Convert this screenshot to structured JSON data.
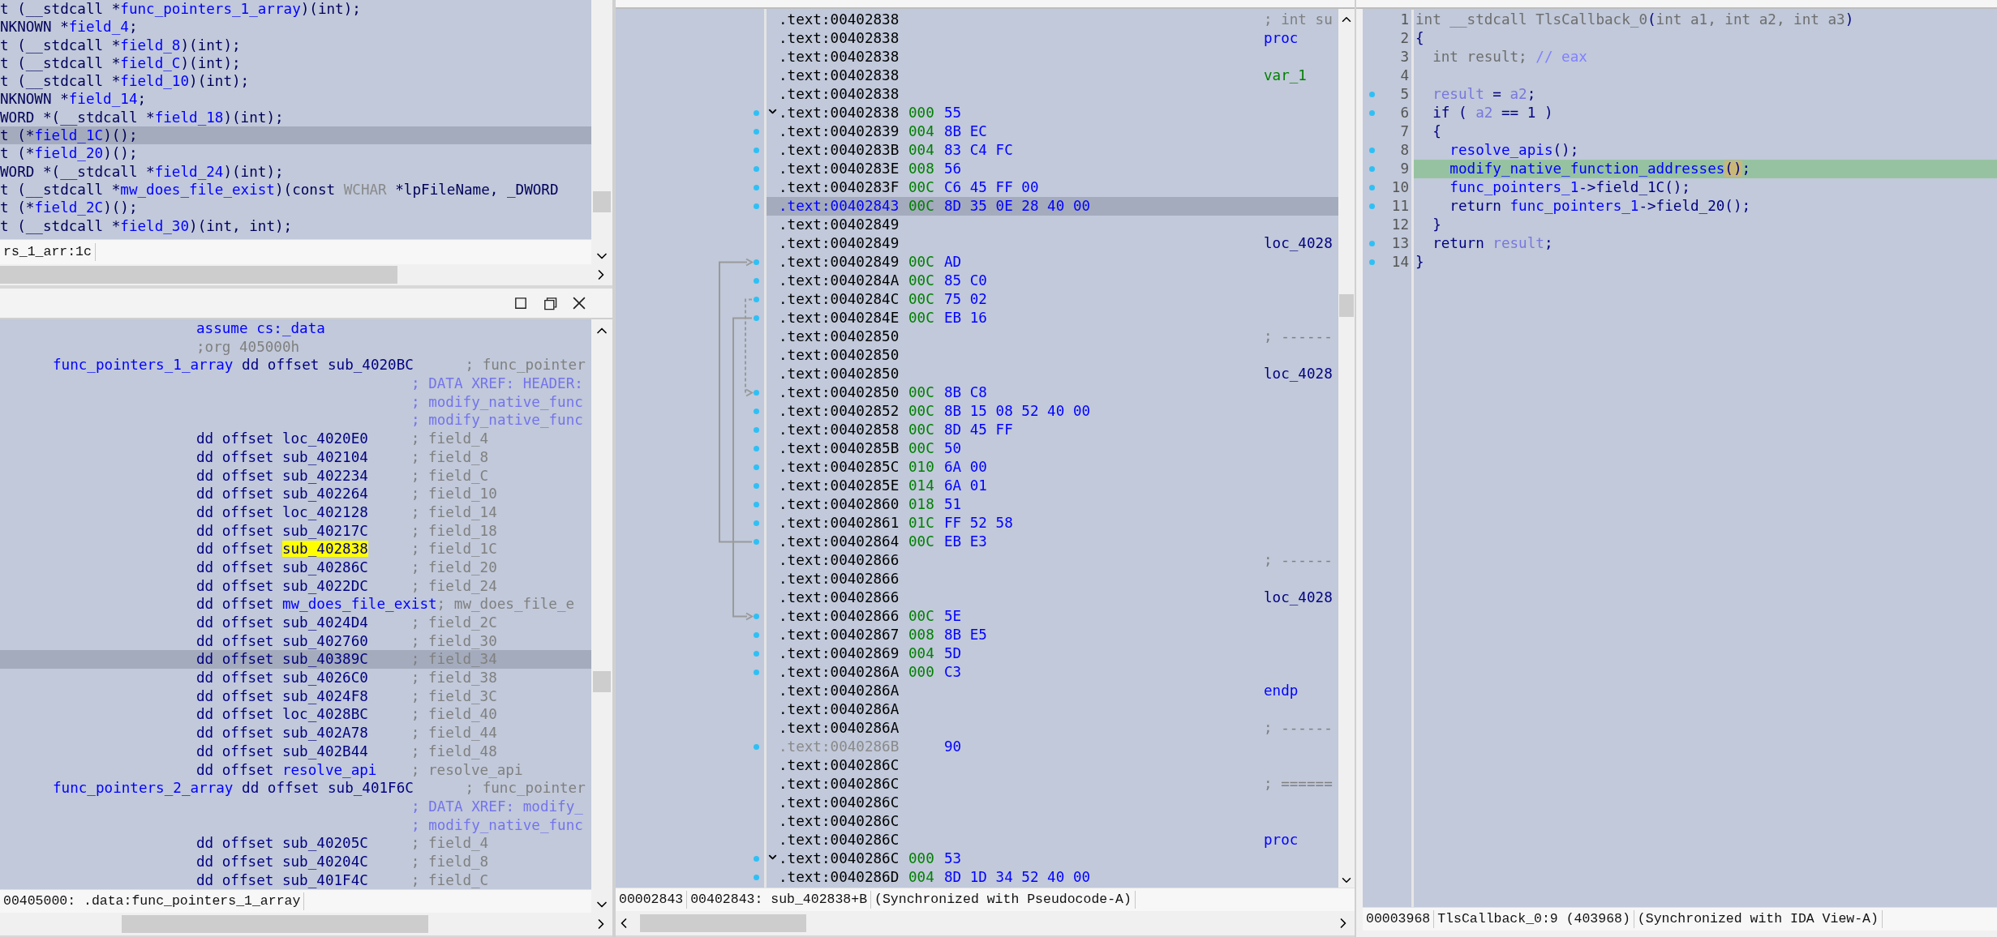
{
  "structure_pane": {
    "lines": [
      {
        "selected": false,
        "segs": [
          {
            "kind": "text",
            "text": "t (__stdcall *"
          },
          {
            "kind": "name",
            "text": "func_pointers_1_array"
          },
          {
            "kind": "text",
            "text": ")(int);"
          }
        ]
      },
      {
        "selected": false,
        "segs": [
          {
            "kind": "text",
            "text": "NKNOWN *"
          },
          {
            "kind": "name",
            "text": "field_4"
          },
          {
            "kind": "text",
            "text": ";"
          }
        ]
      },
      {
        "selected": false,
        "segs": [
          {
            "kind": "text",
            "text": "t (__stdcall *"
          },
          {
            "kind": "name",
            "text": "field_8"
          },
          {
            "kind": "text",
            "text": ")(int);"
          }
        ]
      },
      {
        "selected": false,
        "segs": [
          {
            "kind": "text",
            "text": "t (__stdcall *"
          },
          {
            "kind": "name",
            "text": "field_C"
          },
          {
            "kind": "text",
            "text": ")(int);"
          }
        ]
      },
      {
        "selected": false,
        "segs": [
          {
            "kind": "text",
            "text": "t (__stdcall *"
          },
          {
            "kind": "name",
            "text": "field_10"
          },
          {
            "kind": "text",
            "text": ")(int);"
          }
        ]
      },
      {
        "selected": false,
        "segs": [
          {
            "kind": "text",
            "text": "NKNOWN *"
          },
          {
            "kind": "name",
            "text": "field_14"
          },
          {
            "kind": "text",
            "text": ";"
          }
        ]
      },
      {
        "selected": false,
        "segs": [
          {
            "kind": "text",
            "text": "WORD *(__stdcall *"
          },
          {
            "kind": "name",
            "text": "field_18"
          },
          {
            "kind": "text",
            "text": ")(int);"
          }
        ]
      },
      {
        "selected": true,
        "segs": [
          {
            "kind": "text",
            "text": "t (*"
          },
          {
            "kind": "name",
            "text": "field_1C"
          },
          {
            "kind": "text",
            "text": ")();"
          }
        ]
      },
      {
        "selected": false,
        "segs": [
          {
            "kind": "text",
            "text": "t (*"
          },
          {
            "kind": "name",
            "text": "field_20"
          },
          {
            "kind": "text",
            "text": ")();"
          }
        ]
      },
      {
        "selected": false,
        "segs": [
          {
            "kind": "text",
            "text": "WORD *(__stdcall *"
          },
          {
            "kind": "name",
            "text": "field_24"
          },
          {
            "kind": "text",
            "text": ")(int);"
          }
        ]
      },
      {
        "selected": false,
        "segs": [
          {
            "kind": "text",
            "text": "t (__stdcall *"
          },
          {
            "kind": "name",
            "text": "mw_does_file_exist"
          },
          {
            "kind": "text",
            "text": ")(const "
          },
          {
            "kind": "type",
            "text": "WCHAR"
          },
          {
            "kind": "text",
            "text": " *lpFileName, _DWORD"
          }
        ]
      },
      {
        "selected": false,
        "segs": [
          {
            "kind": "text",
            "text": "t (*"
          },
          {
            "kind": "name",
            "text": "field_2C"
          },
          {
            "kind": "text",
            "text": ")();"
          }
        ]
      },
      {
        "selected": false,
        "segs": [
          {
            "kind": "text",
            "text": "t (__stdcall *"
          },
          {
            "kind": "name",
            "text": "field_30"
          },
          {
            "kind": "text",
            "text": ")(int, int);"
          }
        ]
      }
    ],
    "status": "rs_1_arr:1c"
  },
  "data_view": {
    "lines": [
      {
        "kind": "instr",
        "selected": false,
        "segs": [
          {
            "kind": "name",
            "text": "assume cs:_data"
          }
        ]
      },
      {
        "kind": "instr",
        "selected": false,
        "segs": [
          {
            "kind": "comment",
            "text": ";org 405000h"
          }
        ]
      },
      {
        "kind": "label",
        "selected": false,
        "segs": [
          {
            "kind": "name",
            "text": "func_pointers_1_array"
          },
          {
            "kind": "code",
            "text": " dd offset sub_4020BC"
          },
          {
            "kind": "comment",
            "text": "      ; func_pointer"
          }
        ]
      },
      {
        "kind": "comment",
        "selected": false,
        "segs": [
          {
            "kind": "xref",
            "text": "; DATA XREF: HEADER:"
          }
        ]
      },
      {
        "kind": "comment",
        "selected": false,
        "segs": [
          {
            "kind": "xref",
            "text": "; modify_native_func"
          }
        ]
      },
      {
        "kind": "comment",
        "selected": false,
        "segs": [
          {
            "kind": "xref",
            "text": "; modify_native_func"
          }
        ]
      },
      {
        "kind": "instr",
        "selected": false,
        "segs": [
          {
            "kind": "code",
            "text": "dd offset loc_4020E0"
          },
          {
            "kind": "comment",
            "text": "     ; field_4"
          }
        ]
      },
      {
        "kind": "instr",
        "selected": false,
        "segs": [
          {
            "kind": "code",
            "text": "dd offset sub_402104"
          },
          {
            "kind": "comment",
            "text": "     ; field_8"
          }
        ]
      },
      {
        "kind": "instr",
        "selected": false,
        "segs": [
          {
            "kind": "code",
            "text": "dd offset sub_402234"
          },
          {
            "kind": "comment",
            "text": "     ; field_C"
          }
        ]
      },
      {
        "kind": "instr",
        "selected": false,
        "segs": [
          {
            "kind": "code",
            "text": "dd offset sub_402264"
          },
          {
            "kind": "comment",
            "text": "     ; field_10"
          }
        ]
      },
      {
        "kind": "instr",
        "selected": false,
        "segs": [
          {
            "kind": "code",
            "text": "dd offset loc_402128"
          },
          {
            "kind": "comment",
            "text": "     ; field_14"
          }
        ]
      },
      {
        "kind": "instr",
        "selected": false,
        "segs": [
          {
            "kind": "code",
            "text": "dd offset sub_40217C"
          },
          {
            "kind": "comment",
            "text": "     ; field_18"
          }
        ]
      },
      {
        "kind": "instr",
        "selected": false,
        "segs": [
          {
            "kind": "code",
            "text": "dd offset "
          },
          {
            "kind": "hl",
            "text": "sub_402838"
          },
          {
            "kind": "comment",
            "text": "     ; field_1C"
          }
        ]
      },
      {
        "kind": "instr",
        "selected": false,
        "segs": [
          {
            "kind": "code",
            "text": "dd offset sub_40286C"
          },
          {
            "kind": "comment",
            "text": "     ; field_20"
          }
        ]
      },
      {
        "kind": "instr",
        "selected": false,
        "segs": [
          {
            "kind": "code",
            "text": "dd offset sub_4022DC"
          },
          {
            "kind": "comment",
            "text": "     ; field_24"
          }
        ]
      },
      {
        "kind": "instr",
        "selected": false,
        "segs": [
          {
            "kind": "code",
            "text": "dd offset "
          },
          {
            "kind": "name",
            "text": "mw_does_file_exist"
          },
          {
            "kind": "comment",
            "text": "; mw_does_file_e"
          }
        ]
      },
      {
        "kind": "instr",
        "selected": false,
        "segs": [
          {
            "kind": "code",
            "text": "dd offset sub_4024D4"
          },
          {
            "kind": "comment",
            "text": "     ; field_2C"
          }
        ]
      },
      {
        "kind": "instr",
        "selected": false,
        "segs": [
          {
            "kind": "code",
            "text": "dd offset sub_402760"
          },
          {
            "kind": "comment",
            "text": "     ; field_30"
          }
        ]
      },
      {
        "kind": "instr",
        "selected": true,
        "segs": [
          {
            "kind": "code",
            "text": "dd offset sub_40389C"
          },
          {
            "kind": "comment",
            "text": "     ; field_34"
          }
        ]
      },
      {
        "kind": "instr",
        "selected": false,
        "segs": [
          {
            "kind": "code",
            "text": "dd offset sub_4026C0"
          },
          {
            "kind": "comment",
            "text": "     ; field_38"
          }
        ]
      },
      {
        "kind": "instr",
        "selected": false,
        "segs": [
          {
            "kind": "code",
            "text": "dd offset sub_4024F8"
          },
          {
            "kind": "comment",
            "text": "     ; field_3C"
          }
        ]
      },
      {
        "kind": "instr",
        "selected": false,
        "segs": [
          {
            "kind": "code",
            "text": "dd offset loc_4028BC"
          },
          {
            "kind": "comment",
            "text": "     ; field_40"
          }
        ]
      },
      {
        "kind": "instr",
        "selected": false,
        "segs": [
          {
            "kind": "code",
            "text": "dd offset sub_402A78"
          },
          {
            "kind": "comment",
            "text": "     ; field_44"
          }
        ]
      },
      {
        "kind": "instr",
        "selected": false,
        "segs": [
          {
            "kind": "code",
            "text": "dd offset sub_402B44"
          },
          {
            "kind": "comment",
            "text": "     ; field_48"
          }
        ]
      },
      {
        "kind": "instr",
        "selected": false,
        "segs": [
          {
            "kind": "code",
            "text": "dd offset "
          },
          {
            "kind": "name",
            "text": "resolve_api"
          },
          {
            "kind": "comment",
            "text": "    ; resolve_api"
          }
        ]
      },
      {
        "kind": "label",
        "selected": false,
        "segs": [
          {
            "kind": "name",
            "text": "func_pointers_2_array"
          },
          {
            "kind": "code",
            "text": " dd offset sub_401F6C"
          },
          {
            "kind": "comment",
            "text": "      ; func_pointer"
          }
        ]
      },
      {
        "kind": "comment",
        "selected": false,
        "segs": [
          {
            "kind": "xref",
            "text": "; DATA XREF: modify_"
          }
        ]
      },
      {
        "kind": "comment",
        "selected": false,
        "segs": [
          {
            "kind": "xref",
            "text": "; modify_native_func"
          }
        ]
      },
      {
        "kind": "instr",
        "selected": false,
        "segs": [
          {
            "kind": "code",
            "text": "dd offset sub_40205C"
          },
          {
            "kind": "comment",
            "text": "     ; field_4"
          }
        ]
      },
      {
        "kind": "instr",
        "selected": false,
        "segs": [
          {
            "kind": "code",
            "text": "dd offset sub_40204C"
          },
          {
            "kind": "comment",
            "text": "     ; field_8"
          }
        ]
      },
      {
        "kind": "instr",
        "selected": false,
        "segs": [
          {
            "kind": "code",
            "text": "dd offset sub_401F4C"
          },
          {
            "kind": "comment",
            "text": "     ; field_C"
          }
        ]
      }
    ],
    "status": "00405000: .data:func_pointers_1_array"
  },
  "disassembly": {
    "rows": [
      {
        "addr": ".text:00402838",
        "note": {
          "kind": "comment",
          "text": "; int su"
        },
        "selected": false
      },
      {
        "addr": ".text:00402838",
        "note": {
          "kind": "keyword",
          "text": "proc"
        },
        "selected": false
      },
      {
        "addr": ".text:00402838",
        "selected": false
      },
      {
        "addr": ".text:00402838",
        "note": {
          "kind": "var",
          "text": "var_1"
        },
        "selected": false
      },
      {
        "addr": ".text:00402838",
        "selected": false
      },
      {
        "addr": ".text:00402838",
        "sp": "000",
        "bytes": "55",
        "fold": true,
        "selected": false
      },
      {
        "addr": ".text:00402839",
        "sp": "004",
        "bytes": "8B EC",
        "selected": false
      },
      {
        "addr": ".text:0040283B",
        "sp": "004",
        "bytes": "83 C4 FC",
        "selected": false
      },
      {
        "addr": ".text:0040283E",
        "sp": "008",
        "bytes": "56",
        "selected": false
      },
      {
        "addr": ".text:0040283F",
        "sp": "00C",
        "bytes": "C6 45 FF 00",
        "selected": false
      },
      {
        "addr": ".text:00402843",
        "sp": "00C",
        "bytes": "8D 35 0E 28 40 00",
        "selected": true
      },
      {
        "addr": ".text:00402849",
        "selected": false
      },
      {
        "addr": ".text:00402849",
        "note": {
          "kind": "label",
          "text": "loc_4028"
        },
        "selected": false
      },
      {
        "addr": ".text:00402849",
        "sp": "00C",
        "bytes": "AD",
        "selected": false
      },
      {
        "addr": ".text:0040284A",
        "sp": "00C",
        "bytes": "85 C0",
        "selected": false
      },
      {
        "addr": ".text:0040284C",
        "sp": "00C",
        "bytes": "75 02",
        "selected": false
      },
      {
        "addr": ".text:0040284E",
        "sp": "00C",
        "bytes": "EB 16",
        "selected": false
      },
      {
        "addr": ".text:00402850",
        "note": {
          "kind": "comment",
          "text": "; ------"
        },
        "selected": false
      },
      {
        "addr": ".text:00402850",
        "selected": false
      },
      {
        "addr": ".text:00402850",
        "note": {
          "kind": "label",
          "text": "loc_4028"
        },
        "selected": false
      },
      {
        "addr": ".text:00402850",
        "sp": "00C",
        "bytes": "8B C8",
        "selected": false
      },
      {
        "addr": ".text:00402852",
        "sp": "00C",
        "bytes": "8B 15 08 52 40 00",
        "selected": false
      },
      {
        "addr": ".text:00402858",
        "sp": "00C",
        "bytes": "8D 45 FF",
        "selected": false
      },
      {
        "addr": ".text:0040285B",
        "sp": "00C",
        "bytes": "50",
        "selected": false
      },
      {
        "addr": ".text:0040285C",
        "sp": "010",
        "bytes": "6A 00",
        "selected": false
      },
      {
        "addr": ".text:0040285E",
        "sp": "014",
        "bytes": "6A 01",
        "selected": false
      },
      {
        "addr": ".text:00402860",
        "sp": "018",
        "bytes": "51",
        "selected": false
      },
      {
        "addr": ".text:00402861",
        "sp": "01C",
        "bytes": "FF 52 58",
        "selected": false
      },
      {
        "addr": ".text:00402864",
        "sp": "00C",
        "bytes": "EB E3",
        "selected": false
      },
      {
        "addr": ".text:00402866",
        "note": {
          "kind": "comment",
          "text": "; ------"
        },
        "selected": false
      },
      {
        "addr": ".text:00402866",
        "selected": false
      },
      {
        "addr": ".text:00402866",
        "note": {
          "kind": "label",
          "text": "loc_4028"
        },
        "selected": false
      },
      {
        "addr": ".text:00402866",
        "sp": "00C",
        "bytes": "5E",
        "selected": false
      },
      {
        "addr": ".text:00402867",
        "sp": "008",
        "bytes": "8B E5",
        "selected": false
      },
      {
        "addr": ".text:00402869",
        "sp": "004",
        "bytes": "5D",
        "selected": false
      },
      {
        "addr": ".text:0040286A",
        "sp": "000",
        "bytes": "C3",
        "selected": false
      },
      {
        "addr": ".text:0040286A",
        "note": {
          "kind": "keyword",
          "text": "endp"
        },
        "selected": false
      },
      {
        "addr": ".text:0040286A",
        "selected": false
      },
      {
        "addr": ".text:0040286A",
        "note": {
          "kind": "comment",
          "text": "; ------"
        },
        "selected": false
      },
      {
        "addr": ".text:0040286B",
        "bytes": "90",
        "dim": true,
        "selected": false
      },
      {
        "addr": ".text:0040286C",
        "selected": false
      },
      {
        "addr": ".text:0040286C",
        "note": {
          "kind": "comment",
          "text": "; ======"
        },
        "selected": false
      },
      {
        "addr": ".text:0040286C",
        "selected": false
      },
      {
        "addr": ".text:0040286C",
        "selected": false
      },
      {
        "addr": ".text:0040286C",
        "note": {
          "kind": "keyword",
          "text": "proc"
        },
        "selected": false
      },
      {
        "addr": ".text:0040286C",
        "sp": "000",
        "bytes": "53",
        "fold": true,
        "selected": false
      },
      {
        "addr": ".text:0040286D",
        "sp": "004",
        "bytes": "8D 1D 34 52 40 00",
        "selected": false
      }
    ],
    "status": [
      "00002843",
      "00402843: sub_402838+B",
      "(Synchronized with Pseudocode-A)"
    ]
  },
  "pseudocode": {
    "lines": [
      {
        "num": "1",
        "dot": false,
        "selected": false,
        "segs": [
          {
            "kind": "decl",
            "text": "int __stdcall TlsCallback_0"
          },
          {
            "kind": "code",
            "text": "("
          },
          {
            "kind": "decl",
            "text": "int a1, int a2, int a3"
          },
          {
            "kind": "code",
            "text": ")"
          }
        ]
      },
      {
        "num": "2",
        "dot": false,
        "selected": false,
        "segs": [
          {
            "kind": "code",
            "text": "{"
          }
        ]
      },
      {
        "num": "3",
        "dot": false,
        "selected": false,
        "segs": [
          {
            "kind": "decl",
            "text": "  int result; "
          },
          {
            "kind": "ccomment",
            "text": "// eax"
          }
        ]
      },
      {
        "num": "4",
        "dot": false,
        "selected": false
      },
      {
        "num": "5",
        "dot": true,
        "selected": false,
        "segs": [
          {
            "kind": "var",
            "text": "  result"
          },
          {
            "kind": "code",
            "text": " = "
          },
          {
            "kind": "var",
            "text": "a2"
          },
          {
            "kind": "code",
            "text": ";"
          }
        ]
      },
      {
        "num": "6",
        "dot": true,
        "selected": false,
        "segs": [
          {
            "kind": "code",
            "text": "  if ( "
          },
          {
            "kind": "var",
            "text": "a2"
          },
          {
            "kind": "code",
            "text": " == 1 )"
          }
        ]
      },
      {
        "num": "7",
        "dot": false,
        "selected": false,
        "segs": [
          {
            "kind": "code",
            "text": "  {"
          }
        ]
      },
      {
        "num": "8",
        "dot": true,
        "selected": false,
        "segs": [
          {
            "kind": "name",
            "text": "    resolve_apis"
          },
          {
            "kind": "code",
            "text": "();"
          }
        ]
      },
      {
        "num": "9",
        "dot": true,
        "selected": true,
        "segs": [
          {
            "kind": "name",
            "text": "    modify_native_function_addresses"
          },
          {
            "kind": "paren",
            "text": "()"
          },
          {
            "kind": "code",
            "text": ";"
          }
        ]
      },
      {
        "num": "10",
        "dot": true,
        "selected": false,
        "segs": [
          {
            "kind": "name",
            "text": "    func_pointers_1"
          },
          {
            "kind": "code",
            "text": "->field_1C();"
          }
        ]
      },
      {
        "num": "11",
        "dot": true,
        "selected": false,
        "segs": [
          {
            "kind": "code",
            "text": "    return "
          },
          {
            "kind": "name",
            "text": "func_pointers_1"
          },
          {
            "kind": "code",
            "text": "->field_20();"
          }
        ]
      },
      {
        "num": "12",
        "dot": false,
        "selected": false,
        "segs": [
          {
            "kind": "code",
            "text": "  }"
          }
        ]
      },
      {
        "num": "13",
        "dot": true,
        "selected": false,
        "segs": [
          {
            "kind": "code",
            "text": "  return "
          },
          {
            "kind": "var",
            "text": "result"
          },
          {
            "kind": "code",
            "text": ";"
          }
        ]
      },
      {
        "num": "14",
        "dot": true,
        "selected": false,
        "segs": [
          {
            "kind": "code",
            "text": "}"
          }
        ]
      }
    ],
    "status": [
      "00003968",
      "TlsCallback_0:9 (403968)",
      "(Synchronized with IDA View-A)"
    ]
  }
}
